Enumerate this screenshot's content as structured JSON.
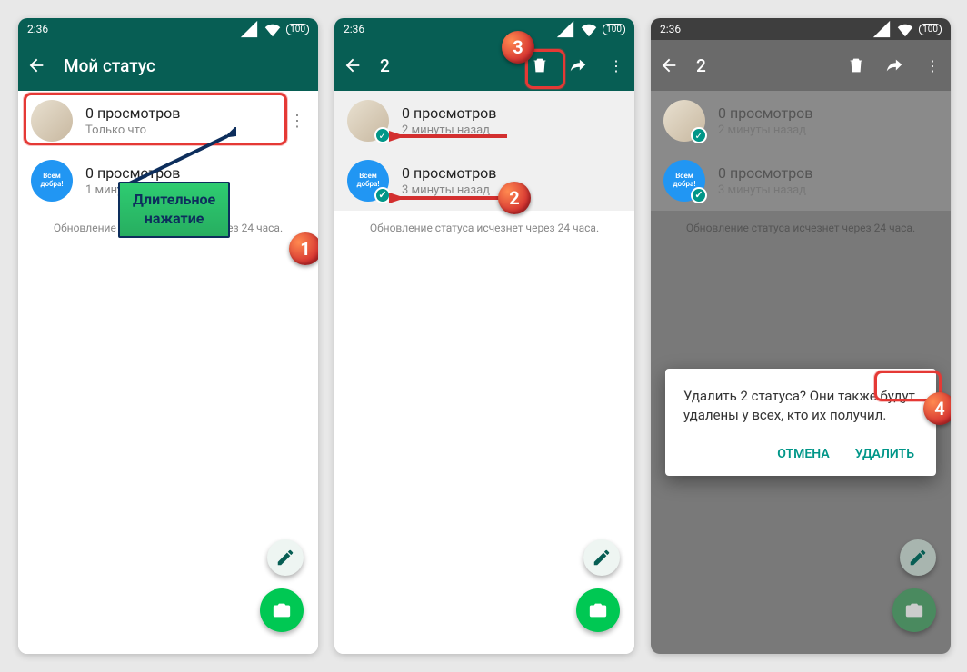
{
  "statusbar": {
    "time": "2:36",
    "battery": "100"
  },
  "screen1": {
    "title": "Мой статус",
    "items": [
      {
        "line1": "0 просмотров",
        "line2": "Только что",
        "avatar_blue_text": ""
      },
      {
        "line1": "0 просмотров",
        "line2": "1 минуту назад",
        "avatar_blue_text": "Всем\nдобра!"
      }
    ],
    "footnote": "Обновление статуса исчезнет через 24 часа."
  },
  "screen2": {
    "title": "2",
    "items": [
      {
        "line1": "0 просмотров",
        "line2": "2 минуты назад"
      },
      {
        "line1": "0 просмотров",
        "line2": "3 минуты назад",
        "avatar_blue_text": "Всем\nдобра!"
      }
    ],
    "footnote": "Обновление статуса исчезнет через 24 часа."
  },
  "screen3": {
    "title": "2",
    "items": [
      {
        "line1": "0 просмотров",
        "line2": "2 минуты назад"
      },
      {
        "line1": "0 просмотров",
        "line2": "3 минуты назад",
        "avatar_blue_text": "Всем\nдобра!"
      }
    ],
    "footnote": "Обновление статуса исчезнет через 24 часа.",
    "dialog": {
      "message": "Удалить 2 статуса? Они также будут удалены у всех, кто их получил.",
      "cancel": "ОТМЕНА",
      "delete": "УДАЛИТЬ"
    }
  },
  "annotations": {
    "callout": "Длительное\nнажатие",
    "badge1": "1",
    "badge2": "2",
    "badge3": "3",
    "badge4": "4"
  }
}
